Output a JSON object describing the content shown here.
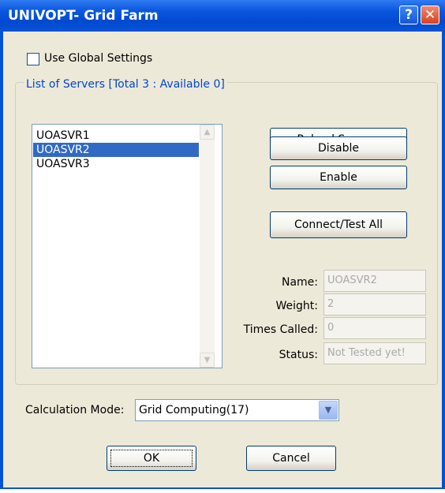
{
  "window": {
    "title": "UNIVOPT- Grid Farm",
    "help_label": "?",
    "close_label": "✕"
  },
  "global_settings": {
    "label": "Use Global Settings",
    "checked": false
  },
  "servers_group": {
    "legend": "List of Servers [Total 3 : Available 0]"
  },
  "servers": [
    {
      "name": "UOASVR1",
      "selected": false
    },
    {
      "name": "UOASVR2",
      "selected": true
    },
    {
      "name": "UOASVR3",
      "selected": false
    }
  ],
  "scroll": {
    "up_icon": "▲",
    "down_icon": "▼"
  },
  "buttons": {
    "reload": "Reload Servers",
    "disable": "Disable",
    "enable": "Enable",
    "connect_test": "Connect/Test All"
  },
  "details": {
    "name_label": "Name:",
    "name_value": "UOASVR2",
    "weight_label": "Weight:",
    "weight_value": "2",
    "times_called_label": "Times Called:",
    "times_called_value": "0",
    "status_label": "Status:",
    "status_value": "Not Tested yet!"
  },
  "calculation_mode": {
    "label": "Calculation Mode:",
    "value": "Grid Computing(17)",
    "arrow_icon": "▼"
  },
  "dialog_buttons": {
    "ok": "OK",
    "cancel": "Cancel"
  },
  "colors": {
    "title_bar": "#0a56de",
    "selection": "#316ac5",
    "legend_text": "#0046d5",
    "dialog_bg": "#ece9d8"
  }
}
